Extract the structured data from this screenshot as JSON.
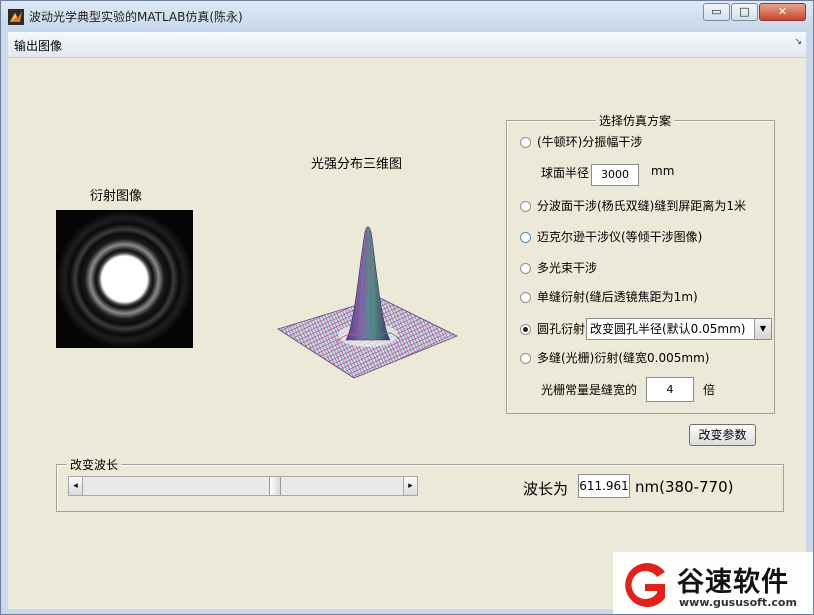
{
  "window": {
    "title": "波动光学典型实验的MATLAB仿真(陈永)",
    "controls": {
      "minimize": "▭",
      "maximize": "□",
      "close": "✕"
    }
  },
  "menu": {
    "items": [
      "输出图像"
    ],
    "overflow_arrow": "↘"
  },
  "labels": {
    "diffraction_title": "衍射图像",
    "surface_title": "光强分布三维图"
  },
  "scheme_panel": {
    "title": "选择仿真方案",
    "options": [
      "(牛顿环)分振幅干涉",
      "分波面干涉(杨氏双缝)缝到屏距离为1米",
      "迈克尔逊干涉仪(等倾干涉图像)",
      "多光束干涉",
      "单缝衍射(缝后透镜焦距为1m)",
      "圆孔衍射",
      "多缝(光栅)衍射(缝宽0.005mm)"
    ],
    "selected_index": 5,
    "sphere_radius_label": "球面半径",
    "sphere_radius_value": "3000",
    "sphere_radius_unit": "mm",
    "aperture_dropdown_value": "改变圆孔半径(默认0.05mm)",
    "grating_label": "光栅常量是缝宽的",
    "grating_value": "4",
    "grating_unit": "倍"
  },
  "change_params_button": "改变参数",
  "wavelength_panel": {
    "title": "改变波长",
    "slider_fraction": 0.6,
    "slider_left_arrow": "◂",
    "slider_right_arrow": "▸",
    "wavelength_label": "波长为",
    "wavelength_value": "611.961",
    "wavelength_unit": "nm(380-770)"
  },
  "watermark": {
    "text": "谷速软件",
    "url": "www.gususoft.com",
    "logo_color": "#e0221c"
  },
  "colors": {
    "title_bar": "#c9d8ea",
    "panel_bg": "#ece9d8",
    "close_button": "#c7452d"
  }
}
